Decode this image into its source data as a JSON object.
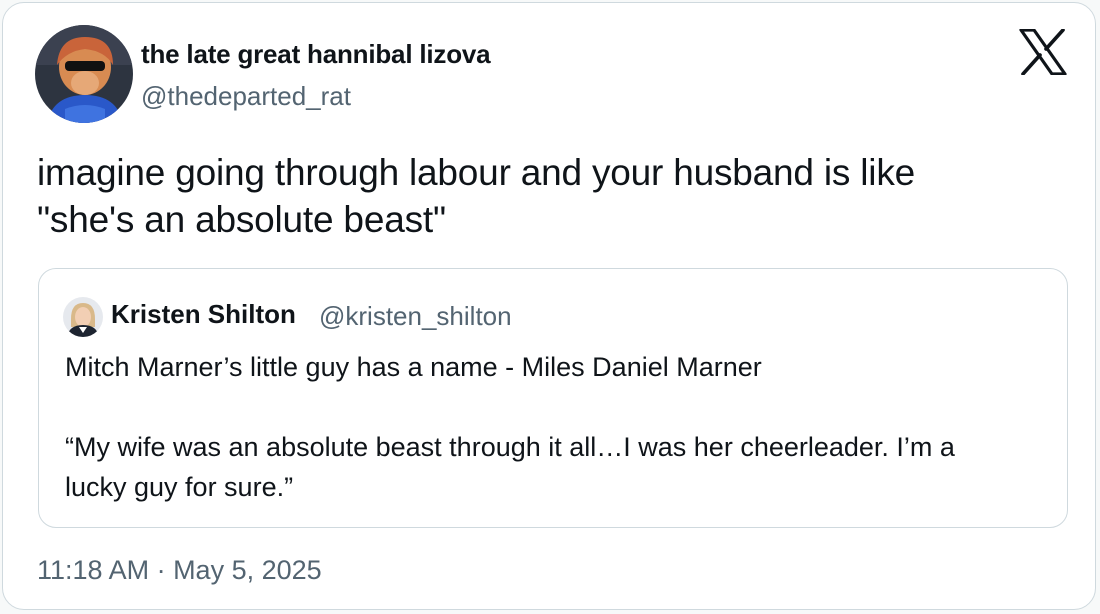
{
  "tweet": {
    "author": {
      "display_name": "the late great hannibal lizova",
      "handle": "@thedeparted_rat"
    },
    "text_lines": [
      "imagine going through labour and your husband is like",
      "\"she's an absolute beast\""
    ],
    "timestamp": "11:18 AM · May 5, 2025"
  },
  "quoted_tweet": {
    "author": {
      "display_name": "Kristen Shilton",
      "handle": "@kristen_shilton"
    },
    "paragraph_1": "Mitch Marner’s little guy has a name - Miles Daniel Marner",
    "paragraph_2_lines": [
      "“My wife was an absolute beast through it all…I was her cheerleader. I’m a",
      "lucky guy for sure.”"
    ]
  },
  "icons": {
    "brand": "x-logo-icon",
    "author_avatar": "avatar-photo",
    "quoted_avatar": "avatar-photo"
  },
  "colors": {
    "text_primary": "#0f1419",
    "text_secondary": "#536471",
    "border": "#cfd9de",
    "background": "#ffffff",
    "page_background": "#f7f9f9"
  }
}
